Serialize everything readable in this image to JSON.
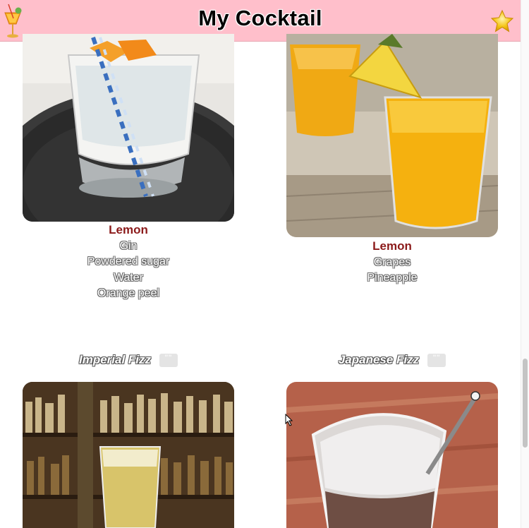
{
  "header": {
    "title": "My Cocktail",
    "logo_icon": "cocktail-glass-icon",
    "favorite_icon": "star-icon"
  },
  "cards": [
    {
      "base": "Lemon",
      "ingredients": [
        "Gin",
        "Powdered sugar",
        "Water",
        "Orange peel"
      ],
      "image": "gin-glass-with-orange-peel-photo"
    },
    {
      "base": "Lemon",
      "ingredients": [
        "Grapes",
        "Pineapple"
      ],
      "image": "orange-juice-with-pineapple-photo"
    },
    {
      "name": "Imperial Fizz",
      "favorite_label": "\"\"",
      "image": "bar-shelf-with-fizz-photo"
    },
    {
      "name": "Japanese Fizz",
      "favorite_label": "\"\"",
      "image": "white-fizz-with-straw-photo"
    }
  ],
  "colors": {
    "header_bg": "#ffbfcb",
    "base_spirit": "#8b1a1a"
  }
}
